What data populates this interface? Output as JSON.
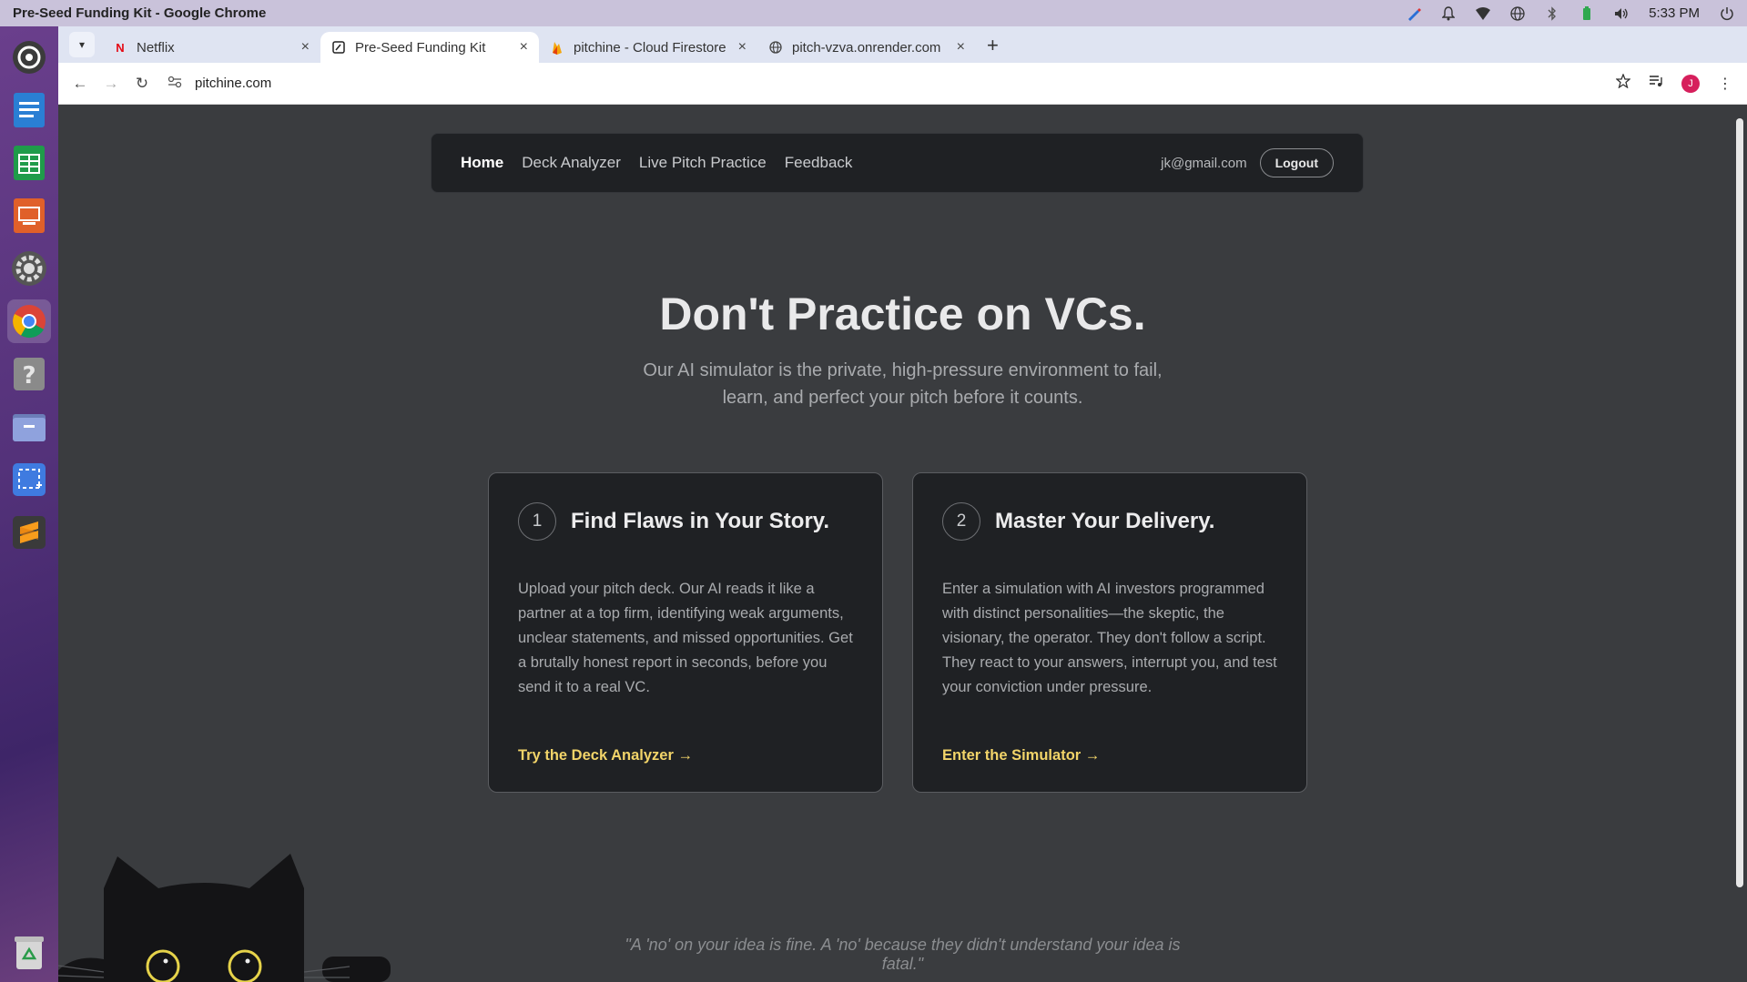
{
  "system": {
    "window_title": "Pre-Seed Funding Kit - Google Chrome",
    "clock": "5:33 PM"
  },
  "tabs": [
    {
      "label": "Netflix",
      "icon": "netflix-icon",
      "active": false
    },
    {
      "label": "Pre-Seed Funding Kit",
      "icon": "page-icon",
      "active": true
    },
    {
      "label": "pitchine - Cloud Firestore",
      "icon": "firebase-icon",
      "active": false
    },
    {
      "label": "pitch-vzva.onrender.com",
      "icon": "globe-icon",
      "active": false
    }
  ],
  "toolbar": {
    "url": "pitchine.com",
    "avatar_letter": "J"
  },
  "site_nav": {
    "items": [
      "Home",
      "Deck Analyzer",
      "Live Pitch Practice",
      "Feedback"
    ],
    "email": "jk@gmail.com",
    "logout": "Logout"
  },
  "hero": {
    "title": "Don't Practice on VCs.",
    "subtitle": "Our AI simulator is the private, high-pressure environment to fail, learn, and perfect your pitch before it counts."
  },
  "cards": [
    {
      "number": "1",
      "title": "Find Flaws in Your Story.",
      "body": "Upload your pitch deck. Our AI reads it like a partner at a top firm, identifying weak arguments, unclear statements, and missed opportunities. Get a brutally honest report in seconds, before you send it to a real VC.",
      "link": "Try the Deck Analyzer →"
    },
    {
      "number": "2",
      "title": "Master Your Delivery.",
      "body": "Enter a simulation with AI investors programmed with distinct personalities—the skeptic, the visionary, the operator. They don't follow a script. They react to your answers, interrupt you, and test your conviction under pressure.",
      "link": "Enter the Simulator →"
    }
  ],
  "quote": "\"A 'no' on your idea is fine. A 'no' because they didn't understand your idea is fatal.\"",
  "colors": {
    "accent_link": "#f2d469",
    "page_bg": "#3a3c3f",
    "card_bg": "#1f2124"
  }
}
